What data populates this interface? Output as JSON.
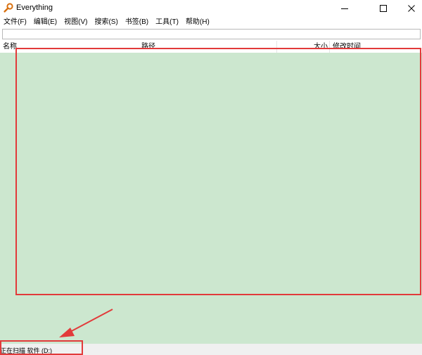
{
  "window": {
    "title": "Everything",
    "app_icon": "magnifier-icon",
    "controls": [
      "minimize-icon",
      "maximize-icon",
      "close-icon"
    ]
  },
  "menu": {
    "file": "文件(F)",
    "edit": "编辑(E)",
    "view": "视图(V)",
    "search": "搜索(S)",
    "bookmarks": "书签(B)",
    "tools": "工具(T)",
    "help": "帮助(H)"
  },
  "search": {
    "value": "",
    "placeholder": ""
  },
  "columns": {
    "name": "名称",
    "path": "路径",
    "size": "大小",
    "modified": "修改时间"
  },
  "status": {
    "text": "正在扫描 软件 (D:)"
  },
  "colors": {
    "results_background": "#cce7cf",
    "annotation": "#e23a3a",
    "status_background": "#f0f0f0",
    "icon_accent": "#d8700f"
  }
}
